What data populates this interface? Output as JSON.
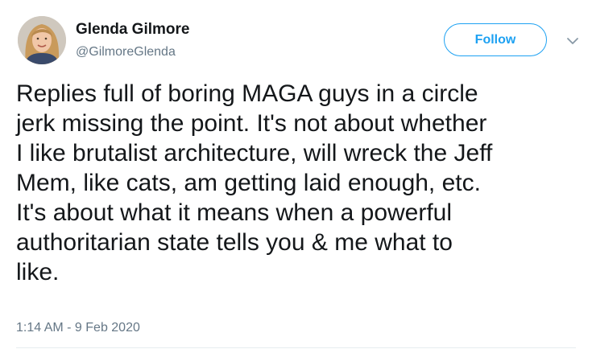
{
  "author": {
    "display_name": "Glenda Gilmore",
    "handle": "@GilmoreGlenda"
  },
  "actions": {
    "follow_label": "Follow",
    "more_icon": "chevron-down-icon"
  },
  "tweet": {
    "text": "Replies full of boring MAGA guys in a circle\njerk missing the point. It's not about whether\nI like brutalist architecture, will wreck the Jeff\nMem, like cats, am getting laid enough, etc.\nIt's about what it means when a powerful\nauthoritarian state tells you & me what to\nlike.",
    "timestamp": "1:14 AM - 9 Feb 2020"
  },
  "colors": {
    "accent": "#1da1f2",
    "secondary_text": "#657786",
    "primary_text": "#14171a"
  }
}
